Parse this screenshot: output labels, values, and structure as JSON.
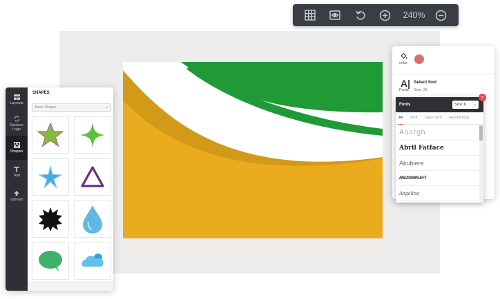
{
  "toolbar": {
    "zoom_level": "240%",
    "buttons": [
      "grid-icon",
      "preview-eye-icon",
      "undo-icon",
      "zoom-in-icon",
      "zoom-out-icon"
    ]
  },
  "sidebar": {
    "items": [
      {
        "label": "Layouts",
        "icon": "layouts-icon"
      },
      {
        "label": "Replace Logo",
        "icon": "replace-logo-icon"
      },
      {
        "label": "Shapes",
        "icon": "shapes-icon",
        "active": true
      },
      {
        "label": "Text",
        "icon": "text-icon"
      },
      {
        "label": "Upload",
        "icon": "upload-icon"
      }
    ]
  },
  "shapes_panel": {
    "title": "SHAPES",
    "select_value": "Basic Shapes",
    "shapes": [
      "green-star-icon",
      "green-four-point-star-icon",
      "blue-star-icon",
      "purple-triangle-icon",
      "black-burst-icon",
      "blue-drop-icon",
      "green-speech-bubble-icon",
      "blue-cloud-icon"
    ]
  },
  "properties": {
    "color_label": "color",
    "color_value": "#d57171",
    "font_icon": "A|",
    "fonts_label": "Fonts",
    "select_font_label": "Select font",
    "size_label": "Size: 35"
  },
  "font_dropdown": {
    "title": "Fonts",
    "size_select": "Size: 6",
    "tabs": [
      "All",
      "Serif",
      "Sans Serif",
      "Handwriting"
    ],
    "active_tab": "All",
    "fonts": [
      "Aaargh",
      "Abril Fatface",
      "Akubiere",
      "AMAZDOOMLEFT",
      "Angelina"
    ]
  },
  "colors": {
    "green": "#1f9a37",
    "gold": "#ebab1e",
    "dark_gold": "#d39a1a",
    "toolbar_bg": "#3a3d43",
    "sidebar_bg": "#2e3035"
  }
}
